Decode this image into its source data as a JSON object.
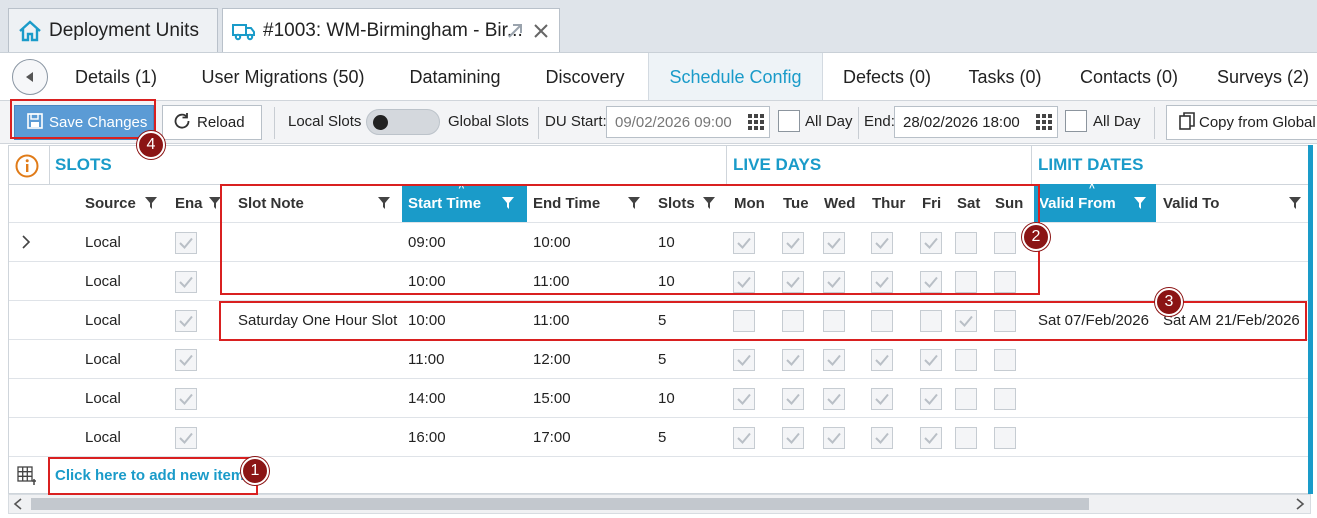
{
  "doc_tabs": {
    "home_label": "Deployment Units",
    "active_label": "#1003: WM-Birmingham - Bir..."
  },
  "module_tabs": [
    "Details (1)",
    "User Migrations (50)",
    "Datamining",
    "Discovery",
    "Schedule Config",
    "Defects (0)",
    "Tasks (0)",
    "Contacts (0)",
    "Surveys (2)"
  ],
  "active_module_tab": "Schedule Config",
  "toolbar": {
    "save_label": "Save Changes",
    "reload_label": "Reload",
    "local_slots_label": "Local Slots",
    "global_slots_label": "Global Slots",
    "du_start_label": "DU Start:",
    "du_start_value": "09/02/2026 09:00",
    "all_day_label": "All Day",
    "end_label": "End:",
    "end_value": "28/02/2026 18:00",
    "all_day_label_2": "All Day",
    "copy_label": "Copy from Global"
  },
  "grid": {
    "groups": {
      "slots": "SLOTS",
      "live_days": "LIVE DAYS",
      "limit_dates": "LIMIT DATES"
    },
    "columns": {
      "source": "Source",
      "enabled": "Ena",
      "slot_note": "Slot Note",
      "start_time": "Start Time",
      "end_time": "End Time",
      "slots": "Slots",
      "mon": "Mon",
      "tue": "Tue",
      "wed": "Wed",
      "thu": "Thur",
      "fri": "Fri",
      "sat": "Sat",
      "sun": "Sun",
      "valid_from": "Valid From",
      "valid_to": "Valid To"
    },
    "rows": [
      {
        "source": "Local",
        "enabled": true,
        "note": "",
        "start": "09:00",
        "end": "10:00",
        "slots": "10",
        "days": [
          true,
          true,
          true,
          true,
          true,
          false,
          false
        ],
        "valid_from": "",
        "valid_to": ""
      },
      {
        "source": "Local",
        "enabled": true,
        "note": "",
        "start": "10:00",
        "end": "11:00",
        "slots": "10",
        "days": [
          true,
          true,
          true,
          true,
          true,
          false,
          false
        ],
        "valid_from": "",
        "valid_to": ""
      },
      {
        "source": "Local",
        "enabled": true,
        "note": "Saturday One Hour Slot",
        "start": "10:00",
        "end": "11:00",
        "slots": "5",
        "days": [
          false,
          false,
          false,
          false,
          false,
          true,
          false
        ],
        "valid_from": "Sat 07/Feb/2026",
        "valid_to": "Sat AM 21/Feb/2026"
      },
      {
        "source": "Local",
        "enabled": true,
        "note": "",
        "start": "11:00",
        "end": "12:00",
        "slots": "5",
        "days": [
          true,
          true,
          true,
          true,
          true,
          false,
          false
        ],
        "valid_from": "",
        "valid_to": ""
      },
      {
        "source": "Local",
        "enabled": true,
        "note": "",
        "start": "14:00",
        "end": "15:00",
        "slots": "10",
        "days": [
          true,
          true,
          true,
          true,
          true,
          false,
          false
        ],
        "valid_from": "",
        "valid_to": ""
      },
      {
        "source": "Local",
        "enabled": true,
        "note": "",
        "start": "16:00",
        "end": "17:00",
        "slots": "5",
        "days": [
          true,
          true,
          true,
          true,
          true,
          false,
          false
        ],
        "valid_from": "",
        "valid_to": ""
      }
    ],
    "add_new_label": "Click here to add new item"
  },
  "callouts": [
    "1",
    "2",
    "3",
    "4"
  ],
  "colors": {
    "accent": "#1a9bc9",
    "highlight": "#d92020",
    "badge": "#8b1414",
    "save_button": "#5b9bd5"
  }
}
